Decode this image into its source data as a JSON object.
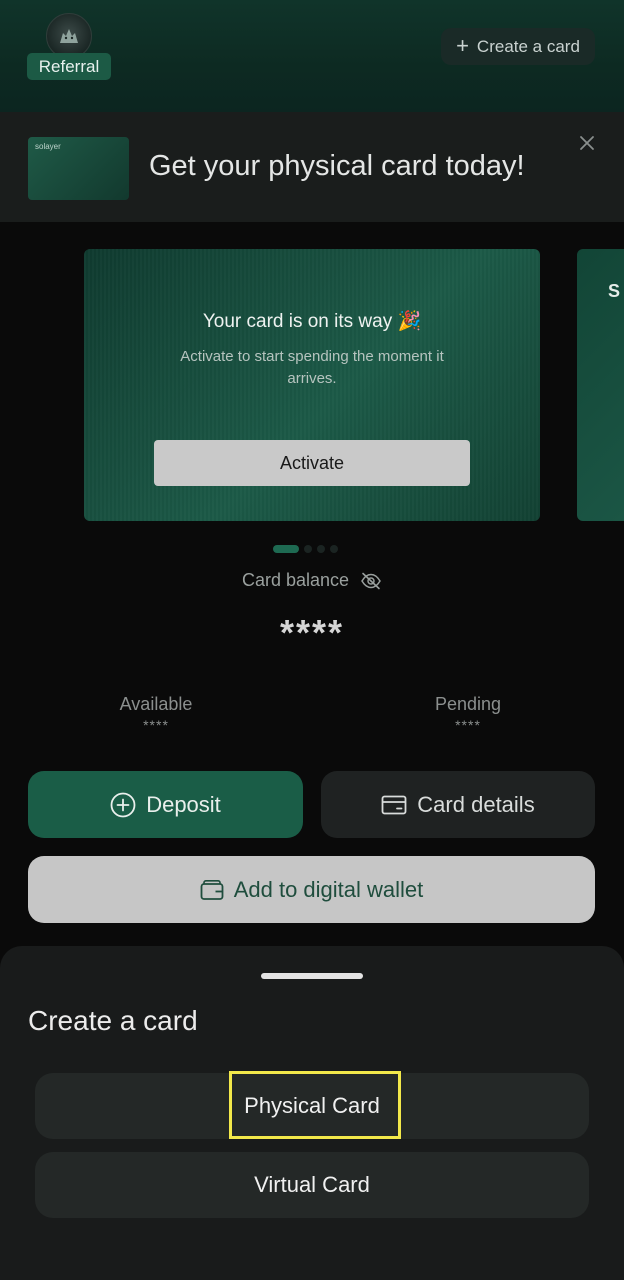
{
  "header": {
    "referral_label": "Referral",
    "create_card_label": "Create a card",
    "avatar_icon": "wolf-avatar-icon",
    "plus_icon": "plus-icon"
  },
  "promo": {
    "thumb_brand": "solayer",
    "title": "Get your physical card today!",
    "close_icon": "close-icon"
  },
  "card": {
    "heading": "Your card is on its way 🎉",
    "subtext": "Activate to start spending the moment it arrives.",
    "activate_label": "Activate",
    "next_card_letter": "S"
  },
  "pager": {
    "count": 4,
    "active_index": 0
  },
  "balance": {
    "label": "Card balance",
    "value": "****",
    "visibility_icon": "eye-off-icon",
    "available_label": "Available",
    "available_value": "****",
    "pending_label": "Pending",
    "pending_value": "****"
  },
  "actions": {
    "deposit_label": "Deposit",
    "card_details_label": "Card details",
    "wallet_label": "Add to digital wallet"
  },
  "sheet": {
    "title": "Create a card",
    "options": [
      {
        "label": "Physical Card"
      },
      {
        "label": "Virtual Card"
      }
    ]
  },
  "colors": {
    "brand_green": "#1a5d47",
    "highlight": "#f2e84a",
    "sheet_bg": "#191b1b"
  }
}
